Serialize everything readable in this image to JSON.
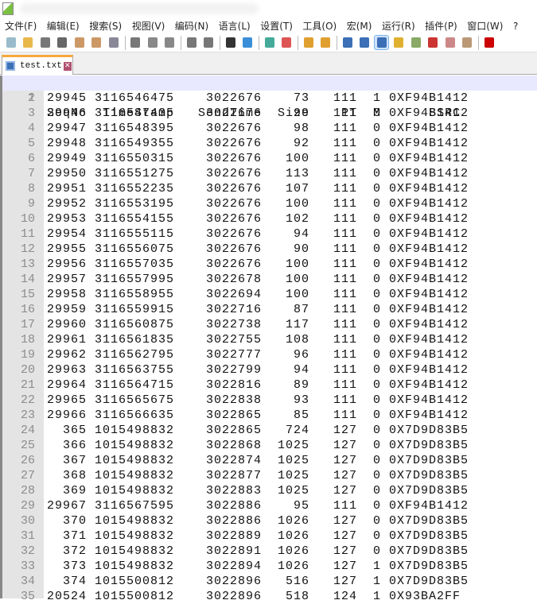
{
  "menu": [
    "文件(F)",
    "编辑(E)",
    "搜索(S)",
    "视图(V)",
    "编码(N)",
    "语言(L)",
    "设置(T)",
    "工具(O)",
    "宏(M)",
    "运行(R)",
    "插件(P)",
    "窗口(W)",
    "?"
  ],
  "toolbar": [
    "new-file",
    "open-file",
    "save",
    "save-all",
    "close",
    "close-all",
    "print",
    "|",
    "cut",
    "copy",
    "paste",
    "|",
    "undo",
    "redo",
    "|",
    "find",
    "replace",
    "|",
    "zoom-in",
    "zoom-out",
    "|",
    "sync-vertical",
    "sync-horizontal",
    "|",
    "word-wrap",
    "show-all-chars",
    "indent-guide",
    "user-language",
    "doc-map",
    "function-list",
    "folder-workspace",
    "monitor",
    "|",
    "record-macro"
  ],
  "tab": {
    "filename": "test.txt",
    "close": "✕"
  },
  "header": "SeqNo  TimeStamp   SendTime  Size    PT  M      SSRC",
  "rows": [
    [
      "29945",
      "3116546475",
      "3022676",
      "73",
      "111",
      "1",
      "0XF94B1412"
    ],
    [
      "29946",
      "3116547435",
      "3022676",
      "99",
      "111",
      "0",
      "0XF94B1412"
    ],
    [
      "29947",
      "3116548395",
      "3022676",
      "98",
      "111",
      "0",
      "0XF94B1412"
    ],
    [
      "29948",
      "3116549355",
      "3022676",
      "92",
      "111",
      "0",
      "0XF94B1412"
    ],
    [
      "29949",
      "3116550315",
      "3022676",
      "100",
      "111",
      "0",
      "0XF94B1412"
    ],
    [
      "29950",
      "3116551275",
      "3022676",
      "113",
      "111",
      "0",
      "0XF94B1412"
    ],
    [
      "29951",
      "3116552235",
      "3022676",
      "107",
      "111",
      "0",
      "0XF94B1412"
    ],
    [
      "29952",
      "3116553195",
      "3022676",
      "100",
      "111",
      "0",
      "0XF94B1412"
    ],
    [
      "29953",
      "3116554155",
      "3022676",
      "102",
      "111",
      "0",
      "0XF94B1412"
    ],
    [
      "29954",
      "3116555115",
      "3022676",
      "94",
      "111",
      "0",
      "0XF94B1412"
    ],
    [
      "29955",
      "3116556075",
      "3022676",
      "90",
      "111",
      "0",
      "0XF94B1412"
    ],
    [
      "29956",
      "3116557035",
      "3022676",
      "100",
      "111",
      "0",
      "0XF94B1412"
    ],
    [
      "29957",
      "3116557995",
      "3022678",
      "100",
      "111",
      "0",
      "0XF94B1412"
    ],
    [
      "29958",
      "3116558955",
      "3022694",
      "100",
      "111",
      "0",
      "0XF94B1412"
    ],
    [
      "29959",
      "3116559915",
      "3022716",
      "87",
      "111",
      "0",
      "0XF94B1412"
    ],
    [
      "29960",
      "3116560875",
      "3022738",
      "117",
      "111",
      "0",
      "0XF94B1412"
    ],
    [
      "29961",
      "3116561835",
      "3022755",
      "108",
      "111",
      "0",
      "0XF94B1412"
    ],
    [
      "29962",
      "3116562795",
      "3022777",
      "96",
      "111",
      "0",
      "0XF94B1412"
    ],
    [
      "29963",
      "3116563755",
      "3022799",
      "94",
      "111",
      "0",
      "0XF94B1412"
    ],
    [
      "29964",
      "3116564715",
      "3022816",
      "89",
      "111",
      "0",
      "0XF94B1412"
    ],
    [
      "29965",
      "3116565675",
      "3022838",
      "93",
      "111",
      "0",
      "0XF94B1412"
    ],
    [
      "29966",
      "3116566635",
      "3022865",
      "85",
      "111",
      "0",
      "0XF94B1412"
    ],
    [
      "365",
      "1015498832",
      "3022865",
      "724",
      "127",
      "0",
      "0X7D9D83B5"
    ],
    [
      "366",
      "1015498832",
      "3022868",
      "1025",
      "127",
      "0",
      "0X7D9D83B5"
    ],
    [
      "367",
      "1015498832",
      "3022874",
      "1025",
      "127",
      "0",
      "0X7D9D83B5"
    ],
    [
      "368",
      "1015498832",
      "3022877",
      "1025",
      "127",
      "0",
      "0X7D9D83B5"
    ],
    [
      "369",
      "1015498832",
      "3022883",
      "1025",
      "127",
      "0",
      "0X7D9D83B5"
    ],
    [
      "29967",
      "3116567595",
      "3022886",
      "95",
      "111",
      "0",
      "0XF94B1412"
    ],
    [
      "370",
      "1015498832",
      "3022886",
      "1026",
      "127",
      "0",
      "0X7D9D83B5"
    ],
    [
      "371",
      "1015498832",
      "3022889",
      "1026",
      "127",
      "0",
      "0X7D9D83B5"
    ],
    [
      "372",
      "1015498832",
      "3022891",
      "1026",
      "127",
      "0",
      "0X7D9D83B5"
    ],
    [
      "373",
      "1015498832",
      "3022894",
      "1026",
      "127",
      "1",
      "0X7D9D83B5"
    ],
    [
      "374",
      "1015500812",
      "3022896",
      "516",
      "127",
      "1",
      "0X7D9D83B5"
    ],
    [
      "20524",
      "1015500812",
      "3022896",
      "518",
      "124",
      "1",
      "0X93BA2FF"
    ]
  ]
}
